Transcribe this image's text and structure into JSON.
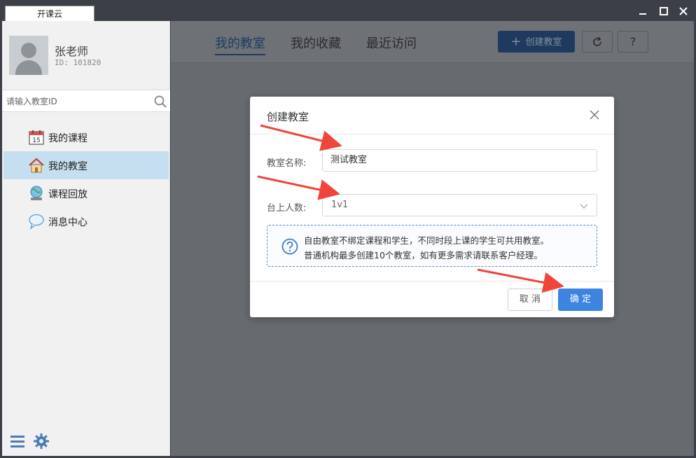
{
  "window": {
    "tab_title": "开课云",
    "controls": [
      "minimize-icon",
      "maximize-icon",
      "close-icon"
    ]
  },
  "user": {
    "name": "张老师",
    "id_text": "ID: 101820"
  },
  "search": {
    "placeholder": "请输入教室ID"
  },
  "sidebar": {
    "items": [
      {
        "label": "我的课程",
        "icon": "calendar-icon",
        "active": false
      },
      {
        "label": "我的教室",
        "icon": "house-icon",
        "active": true
      },
      {
        "label": "课程回放",
        "icon": "globe-icon",
        "active": false
      },
      {
        "label": "消息中心",
        "icon": "chat-bubble-icon",
        "active": false
      }
    ],
    "bottom_icons": [
      "menu-icon",
      "gear-icon"
    ]
  },
  "topnav": {
    "tabs": [
      {
        "label": "我的教室",
        "active": true
      },
      {
        "label": "我的收藏",
        "active": false
      },
      {
        "label": "最近访问",
        "active": false
      }
    ],
    "create_button": "创建教室",
    "refresh_icon": "refresh-icon",
    "help_label": "?"
  },
  "dialog": {
    "title": "创建教室",
    "name_label": "教室名称:",
    "name_value": "测试教室",
    "seats_label": "台上人数:",
    "seats_value": "1v1",
    "notice_line1": "自由教室不绑定课程和学生，不同时段上课的学生可共用教室。",
    "notice_line2": "普通机构最多创建10个教室，如有更多需求请联系客户经理。",
    "cancel_label": "取 消",
    "ok_label": "确 定"
  },
  "colors": {
    "accent": "#3c84e0",
    "arrow": "#f0453a",
    "sidebar_active": "#c5dff0"
  }
}
